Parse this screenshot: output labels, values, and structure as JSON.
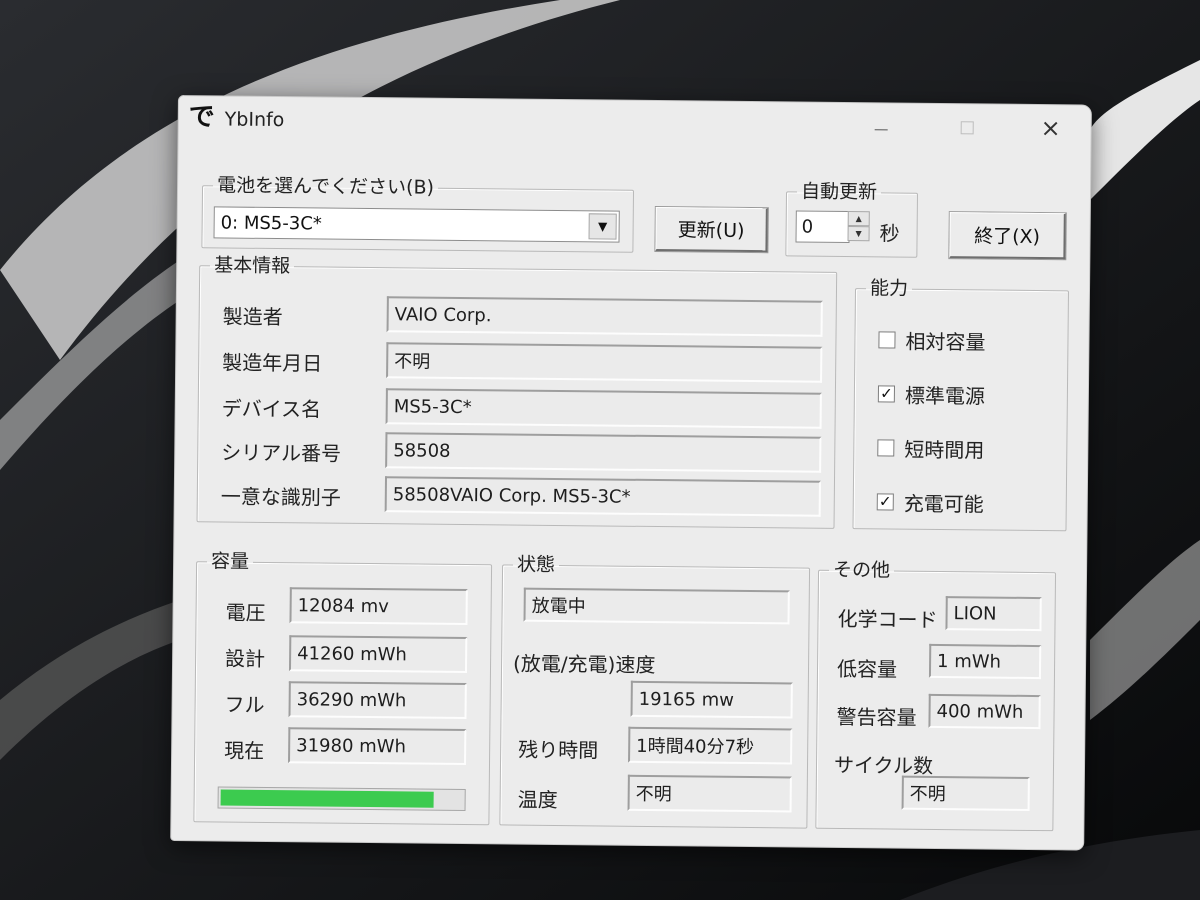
{
  "window": {
    "app_icon": "で",
    "title": "YbInfo",
    "controls": {
      "minimize": "minimize-icon",
      "maximize": "maximize-icon",
      "close": "×"
    }
  },
  "battery_select": {
    "legend": "電池を選んでください(B)",
    "selected": "0: MS5-3C*",
    "arrow": "▼"
  },
  "refresh_button": "更新(U)",
  "auto_update": {
    "legend": "自動更新",
    "value": "0",
    "unit": "秒"
  },
  "exit_button": "終了(X)",
  "basic_info": {
    "legend": "基本情報",
    "rows": [
      {
        "label": "製造者",
        "value": "VAIO Corp."
      },
      {
        "label": "製造年月日",
        "value": "不明"
      },
      {
        "label": "デバイス名",
        "value": "MS5-3C*"
      },
      {
        "label": "シリアル番号",
        "value": "58508"
      },
      {
        "label": "一意な識別子",
        "value": "58508VAIO Corp. MS5-3C*"
      }
    ]
  },
  "capability": {
    "legend": "能力",
    "items": [
      {
        "label": "相対容量",
        "mark": ""
      },
      {
        "label": "標準電源",
        "mark": "✓"
      },
      {
        "label": "短時間用",
        "mark": ""
      },
      {
        "label": "充電可能",
        "mark": "✓"
      }
    ]
  },
  "capacity": {
    "legend": "容量",
    "rows": [
      {
        "label": "電圧",
        "value": "12084 mv"
      },
      {
        "label": "設計",
        "value": "41260 mWh"
      },
      {
        "label": "フル",
        "value": "36290 mWh"
      },
      {
        "label": "現在",
        "value": "31980 mWh"
      }
    ],
    "level_fraction": 0.88,
    "bar_color": "#3ccb4f"
  },
  "status": {
    "legend": "状態",
    "state": "放電中",
    "rate_label": "(放電/充電)速度",
    "rate": "19165 mw",
    "remaining_label": "残り時間",
    "remaining": "1時間40分7秒",
    "temp_label": "温度",
    "temp": "不明"
  },
  "other": {
    "legend": "その他",
    "chem_label": "化学コード",
    "chem": "LION",
    "low_label": "低容量",
    "low": "1 mWh",
    "warn_label": "警告容量",
    "warn": "400 mWh",
    "cycle_label": "サイクル数",
    "cycle": "不明"
  }
}
